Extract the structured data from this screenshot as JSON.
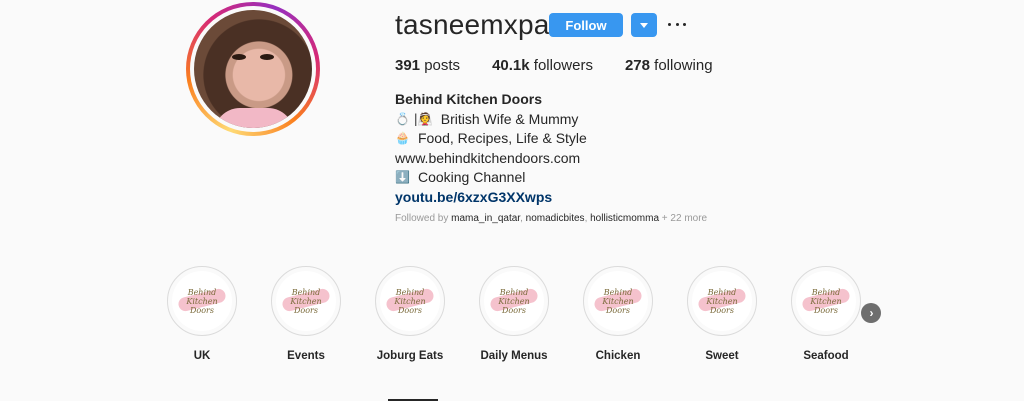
{
  "profile": {
    "username": "tasneemxpatel",
    "follow_label": "Follow",
    "stats": [
      {
        "count": "391",
        "label": " posts"
      },
      {
        "count": "40.1k",
        "label": " followers"
      },
      {
        "count": "278",
        "label": " following"
      }
    ]
  },
  "bio": {
    "name": "Behind Kitchen Doors",
    "lines": [
      {
        "emoji": "💍 |👰",
        "text": "British Wife & Mummy"
      },
      {
        "emoji": "🧁",
        "text": "Food, Recipes, Life & Style"
      },
      {
        "emoji": "",
        "text": "www.behindkitchendoors.com"
      },
      {
        "emoji": "⬇️",
        "text": "Cooking Channel"
      }
    ],
    "link": "youtu.be/6xzxG3XXwps"
  },
  "followed_by": {
    "prefix": "Followed by ",
    "accounts": [
      "mama_in_qatar",
      "nomadicbites",
      "hollisticmomma"
    ],
    "suffix": " + 22 more"
  },
  "highlights": {
    "cover_text": "Behind Kitchen Doors",
    "items": [
      {
        "label": "UK"
      },
      {
        "label": "Events"
      },
      {
        "label": "Joburg Eats"
      },
      {
        "label": "Daily Menus"
      },
      {
        "label": "Chicken"
      },
      {
        "label": "Sweet"
      },
      {
        "label": "Seafood"
      }
    ]
  },
  "icons": {
    "dropdown": "chevron-down-icon",
    "more": "more-options-icon",
    "next": "chevron-right-icon"
  },
  "colors": {
    "accent": "#3897f0",
    "link": "#003569",
    "muted": "#999999"
  }
}
